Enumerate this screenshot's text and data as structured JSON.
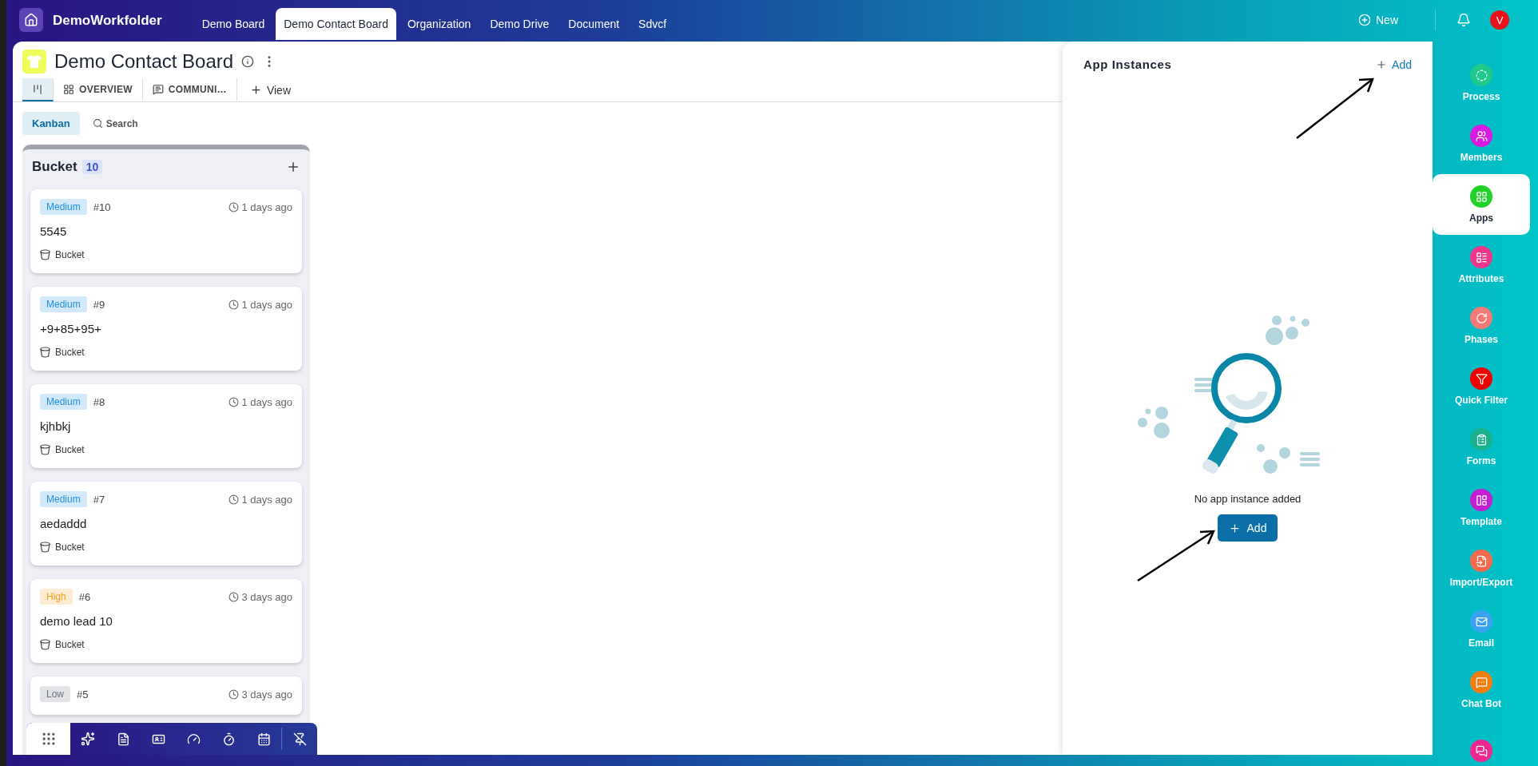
{
  "header": {
    "workspace": "DemoWorkfolder",
    "tabs": [
      {
        "label": "Demo Board",
        "selected": false
      },
      {
        "label": "Demo Contact Board",
        "selected": true
      },
      {
        "label": "Organization",
        "selected": false
      },
      {
        "label": "Demo Drive",
        "selected": false
      },
      {
        "label": "Document",
        "selected": false
      },
      {
        "label": "Sdvcf",
        "selected": false
      }
    ],
    "new_button": "New",
    "avatar": "V"
  },
  "board": {
    "title": "Demo Contact Board",
    "view_tabs": [
      {
        "kind": "kanban",
        "selected": true
      },
      {
        "kind": "overview",
        "label": "OVERVIEW",
        "selected": false
      },
      {
        "kind": "chat",
        "label": "COMMUNI…",
        "selected": false
      }
    ],
    "add_view": "View",
    "view_buttons": [
      {
        "label": "Kanban",
        "selected": true
      }
    ],
    "search_button": "Search"
  },
  "column": {
    "title": "Bucket",
    "count": "10",
    "cards": [
      {
        "priority": {
          "label": "Medium",
          "color": "#1e8fe0"
        },
        "number": "#10",
        "time": "1 days ago",
        "title": "5545",
        "bucket": "Bucket"
      },
      {
        "priority": {
          "label": "Medium",
          "color": "#1e8fe0"
        },
        "number": "#9",
        "time": "1 days ago",
        "title": "+9+85+95+",
        "bucket": "Bucket"
      },
      {
        "priority": {
          "label": "Medium",
          "color": "#1e8fe0"
        },
        "number": "#8",
        "time": "1 days ago",
        "title": "kjhbkj",
        "bucket": "Bucket"
      },
      {
        "priority": {
          "label": "Medium",
          "color": "#1e8fe0"
        },
        "number": "#7",
        "time": "1 days ago",
        "title": "aedaddd",
        "bucket": "Bucket"
      },
      {
        "priority": {
          "label": "High",
          "color": "#f0a020"
        },
        "number": "#6",
        "time": "3 days ago",
        "title": "demo lead 10",
        "bucket": "Bucket"
      },
      {
        "priority": {
          "label": "Low",
          "color": "#6b7280"
        },
        "number": "#5",
        "time": "3 days ago"
      }
    ]
  },
  "app_panel": {
    "title": "App Instances",
    "add_link": "Add",
    "empty_message": "No app instance added",
    "add_button": "Add"
  },
  "sidebar": {
    "items": [
      {
        "kind": "process",
        "label": "Process",
        "color": "#1fc98b",
        "selected": false
      },
      {
        "kind": "members",
        "label": "Members",
        "color": "#d61ce0",
        "selected": false
      },
      {
        "kind": "apps",
        "label": "Apps",
        "color": "#22d12a",
        "selected": true
      },
      {
        "kind": "attributes",
        "label": "Attributes",
        "color": "#f0368b",
        "selected": false
      },
      {
        "kind": "phases",
        "label": "Phases",
        "color": "#f47a78",
        "selected": false
      },
      {
        "kind": "filter",
        "label": "Quick Filter",
        "color": "#f00000",
        "selected": false
      },
      {
        "kind": "forms",
        "label": "Forms",
        "color": "#1ab28c",
        "selected": false
      },
      {
        "kind": "template",
        "label": "Template",
        "color": "#c41fd0",
        "selected": false
      },
      {
        "kind": "import",
        "label": "Import/Export",
        "color": "#f46a4f",
        "selected": false
      },
      {
        "kind": "email",
        "label": "Email",
        "color": "#3ba4f2",
        "selected": false
      },
      {
        "kind": "chatbot",
        "label": "Chat Bot",
        "color": "#f07d12",
        "selected": false
      },
      {
        "kind": "messages",
        "color": "#f0278e",
        "selected": false
      }
    ]
  }
}
